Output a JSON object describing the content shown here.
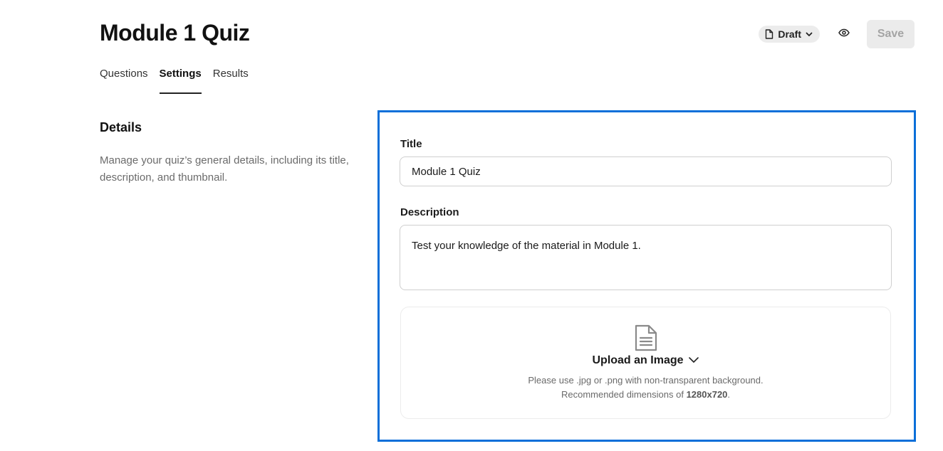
{
  "page": {
    "title": "Module 1 Quiz"
  },
  "header": {
    "status_label": "Draft",
    "status_icon": "document-icon",
    "preview_icon": "eye-icon",
    "save_label": "Save"
  },
  "tabs": [
    {
      "label": "Questions",
      "active": false
    },
    {
      "label": "Settings",
      "active": true
    },
    {
      "label": "Results",
      "active": false
    }
  ],
  "details": {
    "heading": "Details",
    "description": "Manage your quiz’s general details, including its title, description, and thumbnail."
  },
  "form": {
    "title_label": "Title",
    "title_value": "Module 1 Quiz",
    "description_label": "Description",
    "description_value": "Test your knowledge of the material in Module 1.",
    "upload": {
      "label": "Upload an Image",
      "icon": "document-icon",
      "hint_line1": "Please use .jpg or .png with non-transparent background.",
      "hint_line2_prefix": "Recommended dimensions of ",
      "hint_line2_value": "1280x720",
      "hint_line2_suffix": "."
    }
  },
  "colors": {
    "panel_border": "#0b6fd9",
    "save_disabled_bg": "#ebebeb",
    "save_disabled_text": "#a4a4a4"
  }
}
